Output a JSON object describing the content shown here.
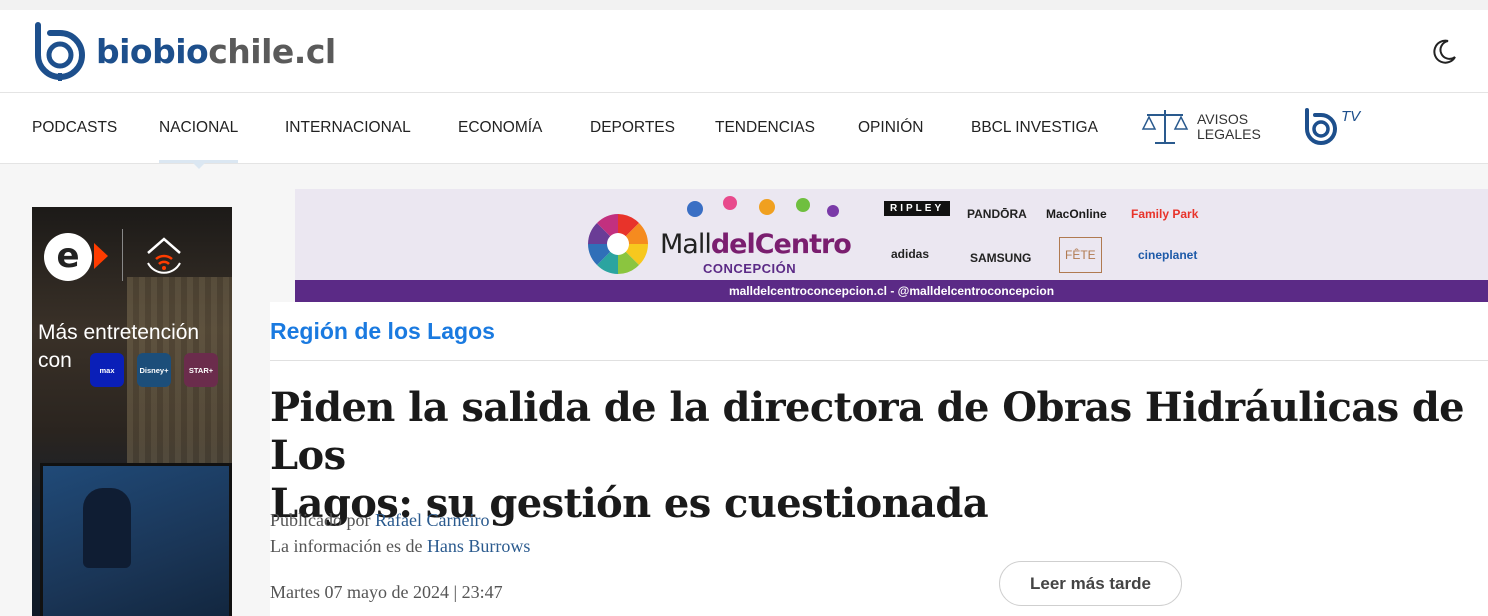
{
  "header": {
    "logo": {
      "bio": "biobio",
      "chile": "chile.cl"
    },
    "dark_mode_icon": "moon-icon"
  },
  "nav": {
    "items": [
      {
        "label": "PODCASTS"
      },
      {
        "label": "NACIONAL",
        "active": true
      },
      {
        "label": "INTERNACIONAL"
      },
      {
        "label": "ECONOMÍA"
      },
      {
        "label": "DEPORTES"
      },
      {
        "label": "TENDENCIAS"
      },
      {
        "label": "OPINIÓN"
      },
      {
        "label": "BBCL INVESTIGA"
      }
    ],
    "avisos": {
      "line1": "AVISOS",
      "line2": "LEGALES",
      "icon": "scales-icon"
    },
    "tv": {
      "label": "TV",
      "icon": "biobio-tv-icon"
    }
  },
  "left_ad": {
    "tagline": "Más entretención con",
    "chips": [
      "max",
      "Disney+",
      "STAR+"
    ]
  },
  "banner": {
    "mall_prefix": "Mall",
    "mall_name": "delCentro",
    "city": "CONCEPCIÓN",
    "brands": [
      "RIPLEY",
      "PANDŌRA",
      "MacOnline",
      "Family Park",
      "adidas",
      "SAMSUNG",
      "FÊTE",
      "cineplanet"
    ],
    "footer": "malldelcentroconcepcion.cl - @malldelcentroconcepcion"
  },
  "article": {
    "section": "Región de los Lagos",
    "headline_line1": "Piden la salida de la directora de Obras Hidráulicas de Los",
    "headline_line2": "Lagos: su gestión es cuestionada",
    "published_prefix": "Publicado por ",
    "author": "Rafael Carneiro",
    "info_prefix": "La información es de ",
    "source": "Hans Burrows",
    "date": "Martes 07 mayo de 2024 | 23:47",
    "read_later": "Leer más tarde"
  },
  "colors": {
    "brand_blue": "#1d4f8c",
    "section_blue": "#1a7ae0",
    "link_blue": "#2a5a8e",
    "banner_purple": "#5b2a86"
  }
}
